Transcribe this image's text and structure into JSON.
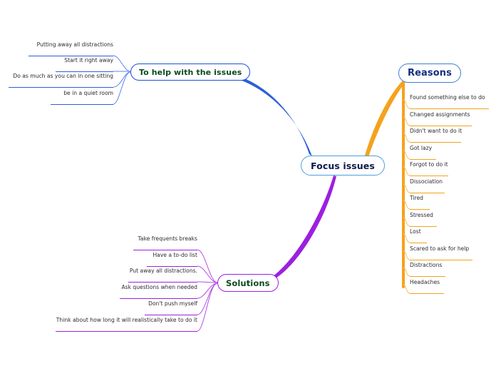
{
  "diagram": {
    "type": "mind-map",
    "title": "Focus issues",
    "background": "#ffffff",
    "colors": {
      "center_border": "#4a9fe0",
      "center_text": "#0d1a4a",
      "branch_blue": "#2b5fd9",
      "branch_orange": "#f5a21e",
      "branch_purple": "#9b20e0",
      "leaf_text": "#2b2b33",
      "node_green_text": "#0b4a20",
      "reasons_text": "#12307e"
    }
  },
  "center": {
    "label": "Focus issues"
  },
  "branches": [
    {
      "id": "help",
      "label": "To help with the issues",
      "color": "#2b5fd9",
      "side": "left",
      "items": [
        "Putting away all distractions",
        "Start it right away",
        "Do as much as you can in one sitting",
        "be in  a quiet room"
      ]
    },
    {
      "id": "reasons",
      "label": "Reasons",
      "color": "#f5a21e",
      "side": "right",
      "items": [
        "Found something else to do",
        "Changed assignments",
        "Didn't  want to do it",
        "Got lazy",
        "Forgot to do it",
        "Dissociation",
        "Tired",
        "Stressed",
        "Lost",
        "Scared to ask for help",
        "Distractions",
        "Headaches"
      ]
    },
    {
      "id": "solutions",
      "label": "Solutions",
      "color": "#9b20e0",
      "side": "left",
      "items": [
        "Take frequents breaks",
        "Have a to-do list",
        "Put away all distractions.",
        "Ask questions when needed",
        "Don't push myself",
        "Think about how long it will realistically take to do it"
      ]
    }
  ]
}
